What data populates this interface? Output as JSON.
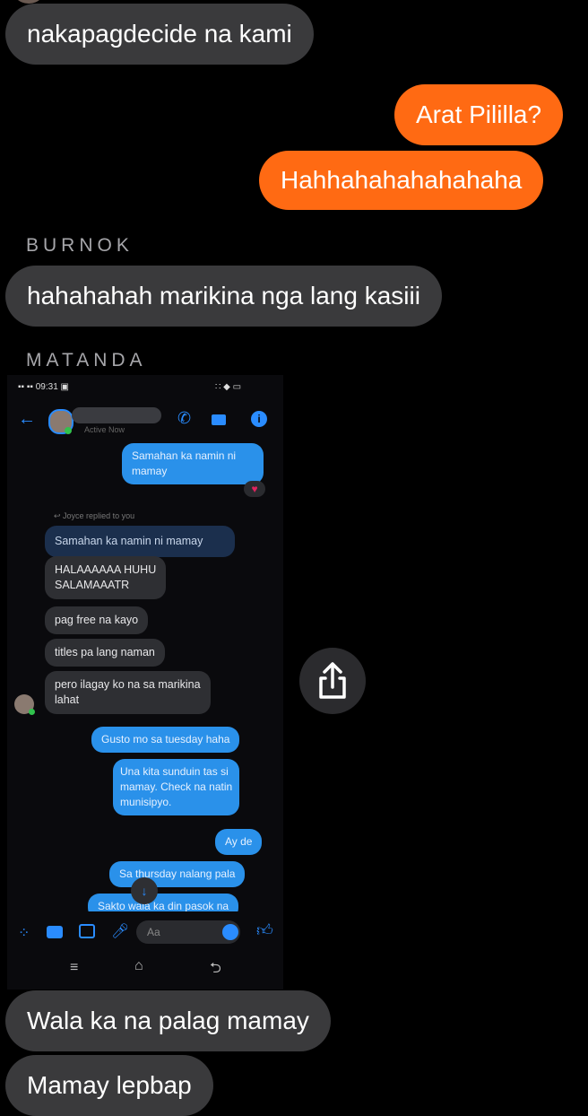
{
  "messages": {
    "m1": "nakapagdecide na kami",
    "m2": "Arat Pililla?",
    "m3": "Hahhahahahahahaha",
    "sender1": "BURNOK",
    "m4": "hahahahah marikina nga lang kasiii",
    "sender2": "MATANDA",
    "m5": "Wala ka na palag mamay",
    "m6": "Mamay lepbap"
  },
  "shot": {
    "status_time": "09:31",
    "active": "Active Now",
    "out1": "Samahan ka namin ni mamay",
    "reply_label": "Joyce replied to you",
    "quoted": "Samahan ka namin ni mamay",
    "in1a": "HALAAAAAA HUHU",
    "in1b": "SALAMAAATR",
    "in2": "pag free na kayo",
    "in3": "titles pa lang naman",
    "in4a": "pero ilagay ko na sa marikina",
    "in4b": "lahat",
    "out2": "Gusto mo sa tuesday haha",
    "out3a": "Una kita sunduin tas si",
    "out3b": "mamay. Check na natin",
    "out3c": "munisipyo.",
    "out4": "Ay de",
    "out5": "Sa thursday nalang pala",
    "out6": "Sakto wala ka din pasok na",
    "compose_placeholder": "Aa"
  },
  "colors": {
    "outgoing": "#ff6a13",
    "incoming": "#3a3a3c",
    "messenger_blue": "#2a91ea"
  }
}
